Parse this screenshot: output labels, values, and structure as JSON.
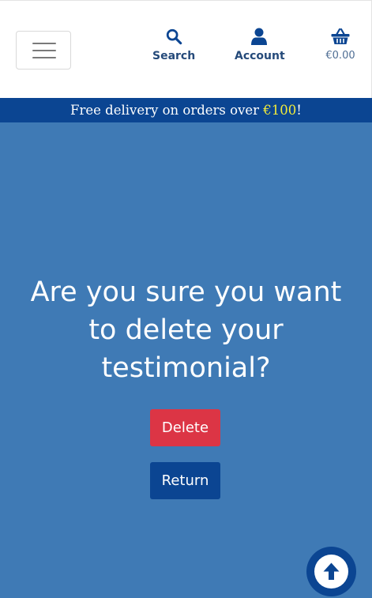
{
  "header": {
    "menu_icon": "hamburger-menu-icon",
    "search": {
      "icon": "search-icon",
      "label": "Search"
    },
    "account": {
      "icon": "user-icon",
      "label": "Account"
    },
    "basket": {
      "icon": "basket-icon",
      "total": "€0.00"
    }
  },
  "banner": {
    "text_before": "Free delivery on orders over ",
    "highlight": "€100",
    "text_after": "!"
  },
  "main": {
    "question": "Are you sure you want to delete your testimonial?",
    "delete_label": "Delete",
    "return_label": "Return"
  },
  "scroll_top": {
    "icon": "arrow-up-icon"
  },
  "colors": {
    "header_bg": "#ffffff",
    "banner_bg": "#0b4592",
    "page_bg": "#3f7ab5",
    "highlight": "#f2ec3a",
    "delete_button": "#dc3545",
    "return_button": "#0b4592"
  }
}
